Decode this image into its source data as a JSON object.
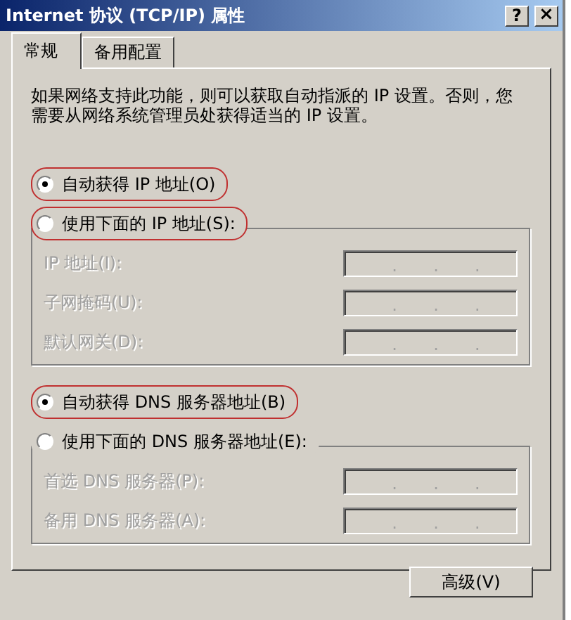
{
  "window": {
    "title": "Internet 协议 (TCP/IP) 属性",
    "buttons": [
      {
        "kind": "help",
        "label": "?"
      },
      {
        "kind": "close",
        "label": "×"
      }
    ]
  },
  "tabs": [
    {
      "label": "常规",
      "selected": true
    },
    {
      "label": "备用配置",
      "selected": false
    }
  ],
  "description": "如果网络支持此功能，则可以获取自动指派的 IP 设置。否则，您需要从网络系统管理员处获得适当的 IP 设置。",
  "sections": [
    {
      "auto": {
        "label": "自动获得 IP 地址(O)",
        "selected": true,
        "highlighted": true
      },
      "manual": {
        "label": "使用下面的 IP 地址(S):",
        "selected": false,
        "highlighted": true
      },
      "fields": [
        {
          "label": "IP 地址(I):",
          "disabled": true,
          "dots": [
            ".",
            ".",
            "."
          ]
        },
        {
          "label": "子网掩码(U):",
          "disabled": true,
          "dots": [
            ".",
            ".",
            "."
          ]
        },
        {
          "label": "默认网关(D):",
          "disabled": true,
          "dots": [
            ".",
            ".",
            "."
          ]
        }
      ]
    },
    {
      "auto": {
        "label": "自动获得 DNS 服务器地址(B)",
        "selected": true,
        "highlighted": true
      },
      "manual": {
        "label": "使用下面的 DNS 服务器地址(E):",
        "selected": false,
        "highlighted": false
      },
      "fields": [
        {
          "label": "首选 DNS 服务器(P):",
          "disabled": true,
          "dots": [
            ".",
            ".",
            "."
          ]
        },
        {
          "label": "备用 DNS 服务器(A):",
          "disabled": true,
          "dots": [
            ".",
            ".",
            "."
          ]
        }
      ]
    }
  ],
  "advanced_button": {
    "label": "高级(V)"
  }
}
